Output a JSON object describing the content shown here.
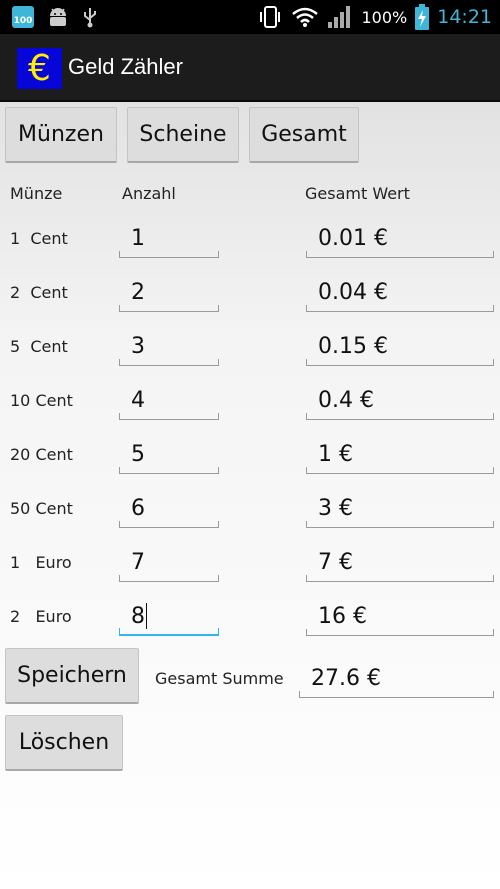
{
  "statusbar": {
    "battery_badge": "100",
    "battery_percent": "100%",
    "clock": "14:21",
    "icons": [
      "battery-notification-icon",
      "android-debug-icon",
      "usb-icon",
      "vibrate-icon",
      "wifi-icon",
      "signal-icon",
      "battery-charging-icon"
    ]
  },
  "app": {
    "icon_glyph": "€",
    "title": "Geld Zähler"
  },
  "tabs": [
    {
      "label": "Münzen"
    },
    {
      "label": "Scheine"
    },
    {
      "label": "Gesamt"
    }
  ],
  "table": {
    "headers": [
      "Münze",
      "Anzahl",
      "Gesamt Wert"
    ],
    "rows": [
      {
        "coin": "1  Cent",
        "count": "1",
        "value": "0.01 €"
      },
      {
        "coin": "2  Cent",
        "count": "2",
        "value": "0.04 €"
      },
      {
        "coin": "5  Cent",
        "count": "3",
        "value": "0.15 €"
      },
      {
        "coin": "10 Cent",
        "count": "4",
        "value": "0.4 €"
      },
      {
        "coin": "20 Cent",
        "count": "5",
        "value": "1 €"
      },
      {
        "coin": "50 Cent",
        "count": "6",
        "value": "3 €"
      },
      {
        "coin": "1   Euro",
        "count": "7",
        "value": "7 €"
      },
      {
        "coin": "2   Euro",
        "count": "8",
        "value": "16 €"
      }
    ]
  },
  "footer": {
    "save_label": "Speichern",
    "sum_label": "Gesamt Summe",
    "sum_value": "27.6 €",
    "clear_label": "Löschen"
  },
  "colors": {
    "accent": "#33b5e5",
    "status_clock": "#3fb6d8",
    "app_icon_bg": "#0606d8",
    "app_icon_fg": "#ffee00"
  }
}
